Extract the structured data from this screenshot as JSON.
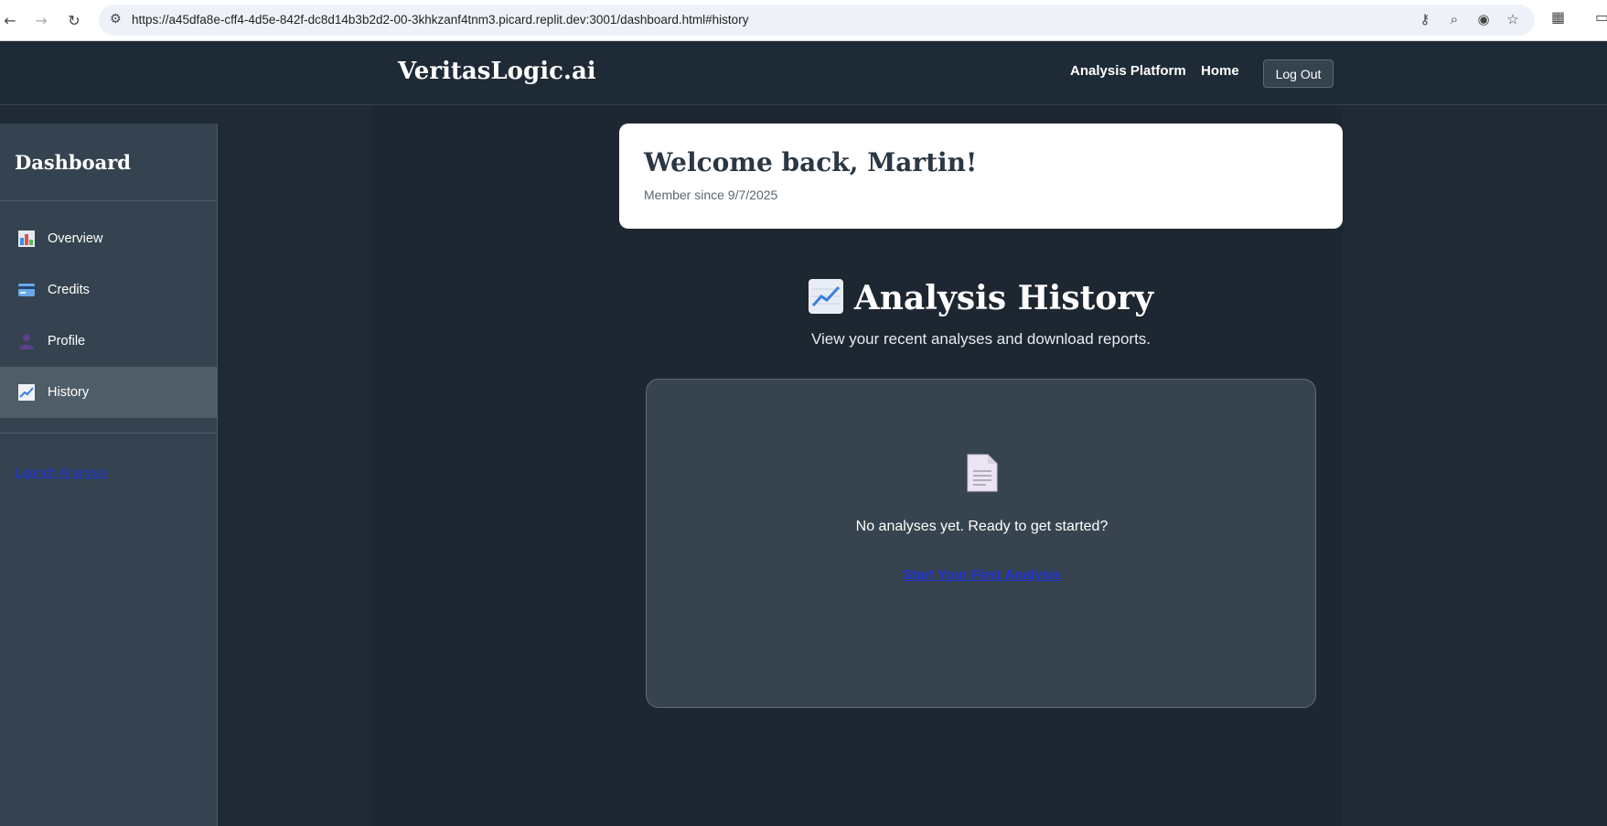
{
  "browser": {
    "url": "https://a45dfa8e-cff4-4d5e-842f-dc8d14b3b2d2-00-3khkzanf4tnm3.picard.replit.dev:3001/dashboard.html#history",
    "icons": [
      "back-icon",
      "forward-icon",
      "reload-icon",
      "site-info-icon",
      "key-icon",
      "zoom-icon",
      "eye-off-icon",
      "star-icon",
      "extensions-icon"
    ]
  },
  "header": {
    "brand": "VeritasLogic.ai",
    "nav": [
      "Analysis Platform",
      "Home"
    ],
    "logout_label": "Log Out"
  },
  "sidebar": {
    "title": "Dashboard",
    "items": [
      {
        "label": "Overview",
        "icon": "bar-chart-icon"
      },
      {
        "label": "Credits",
        "icon": "credit-card-icon"
      },
      {
        "label": "Profile",
        "icon": "user-icon"
      },
      {
        "label": "History",
        "icon": "trend-chart-icon",
        "active": true
      }
    ],
    "launch_link": "Launch Analysis"
  },
  "welcome": {
    "title": "Welcome back, Martin!",
    "member_since": "Member since 9/7/2025"
  },
  "history": {
    "title": "Analysis History",
    "subtitle": "View your recent analyses and download reports.",
    "empty_message": "No analyses yet. Ready to get started?",
    "cta": "Start Your First Analysis"
  },
  "colors": {
    "background": "#1f2a35",
    "sidebar": "#34434f",
    "sidebar_active": "#4f5d69",
    "card": "#37444f",
    "link": "#1f32d8"
  }
}
